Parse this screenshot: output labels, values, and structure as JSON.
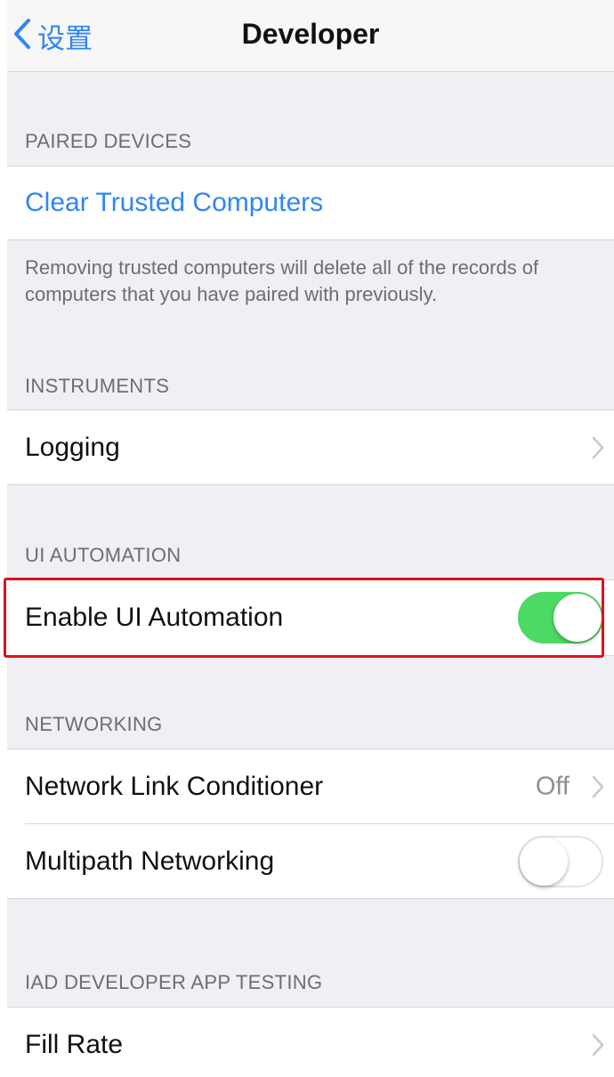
{
  "navbar": {
    "back_label": "设置",
    "title": "Developer"
  },
  "sections": {
    "paired_devices": {
      "header": "PAIRED DEVICES",
      "clear_label": "Clear Trusted Computers",
      "footer": "Removing trusted computers will delete all of the records of computers that you have paired with previously."
    },
    "instruments": {
      "header": "INSTRUMENTS",
      "logging_label": "Logging"
    },
    "ui_automation": {
      "header": "UI AUTOMATION",
      "enable_label": "Enable UI Automation",
      "enable_on": true
    },
    "networking": {
      "header": "NETWORKING",
      "nlc_label": "Network Link Conditioner",
      "nlc_value": "Off",
      "multipath_label": "Multipath Networking",
      "multipath_on": false
    },
    "iad": {
      "header": "IAD DEVELOPER APP TESTING",
      "fill_rate_label": "Fill Rate"
    }
  },
  "colors": {
    "accent": "#2f86f5",
    "toggle_on": "#4cd964",
    "highlight": "#e1101c",
    "group_bg": "#efeff4"
  },
  "icons": {
    "back": "chevron-left-icon",
    "disclosure": "chevron-right-icon"
  }
}
